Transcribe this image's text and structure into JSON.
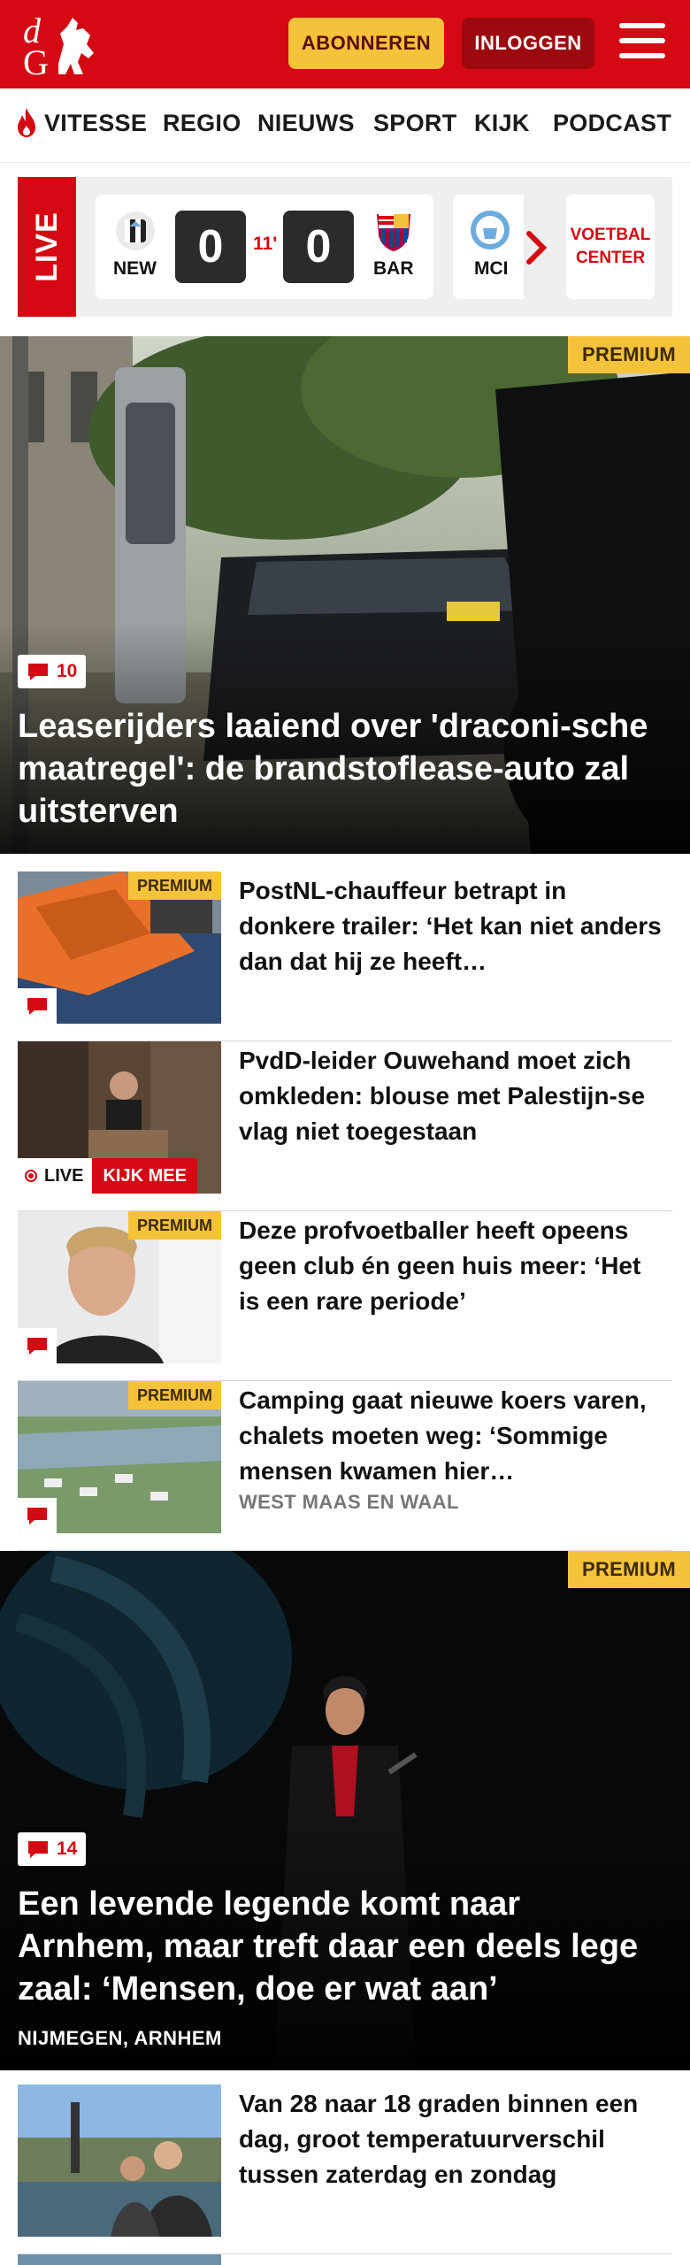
{
  "header": {
    "logo_text": "dG",
    "subscribe_label": "ABONNEREN",
    "login_label": "INLOGGEN",
    "brand_color": "#d40913",
    "accent_color": "#f5c23b"
  },
  "nav": {
    "items": [
      "VITESSE",
      "REGIO",
      "NIEUWS",
      "SPORT",
      "KIJK",
      "PODCAST"
    ]
  },
  "live_scores": {
    "tag": "LIVE",
    "match": {
      "home_code": "NEW",
      "away_code": "BAR",
      "home_score": "0",
      "away_score": "0",
      "minute": "11'"
    },
    "next_match_code": "MCI",
    "center_label_line1": "VOETBAL",
    "center_label_line2": "CENTER"
  },
  "hero1": {
    "premium": "PREMIUM",
    "comments": "10",
    "title": "Leaserijders laaiend over 'draconi-sche maatregel': de brandstoflease-auto zal uitsterven"
  },
  "articles": [
    {
      "title": "PostNL-chauffeur betrapt in donkere trailer: ‘Het kan niet anders dan dat hij ze heeft…",
      "premium": "PREMIUM"
    },
    {
      "title": "PvdD-leider Ouwehand moet zich omkleden: blouse met Palestijn-se vlag niet toegestaan",
      "live_label": "LIVE",
      "watch_label": "KIJK MEE"
    },
    {
      "title": "Deze profvoetballer heeft opeens geen club én geen huis meer: ‘Het is een rare periode’",
      "premium": "PREMIUM"
    },
    {
      "title": "Camping gaat nieuwe koers varen, chalets moeten weg: ‘Sommige mensen kwamen hier…",
      "premium": "PREMIUM",
      "tag": "WEST MAAS EN WAAL"
    }
  ],
  "hero2": {
    "premium": "PREMIUM",
    "comments": "14",
    "title": "Een levende legende komt naar Arnhem, maar treft daar een deels lege zaal: ‘Mensen, doe er wat aan’",
    "tag": "NIJMEGEN, ARNHEM"
  },
  "articles2": [
    {
      "title": "Van 28 naar 18 graden binnen een dag, groot temperatuurverschil tussen zaterdag en zondag"
    }
  ]
}
